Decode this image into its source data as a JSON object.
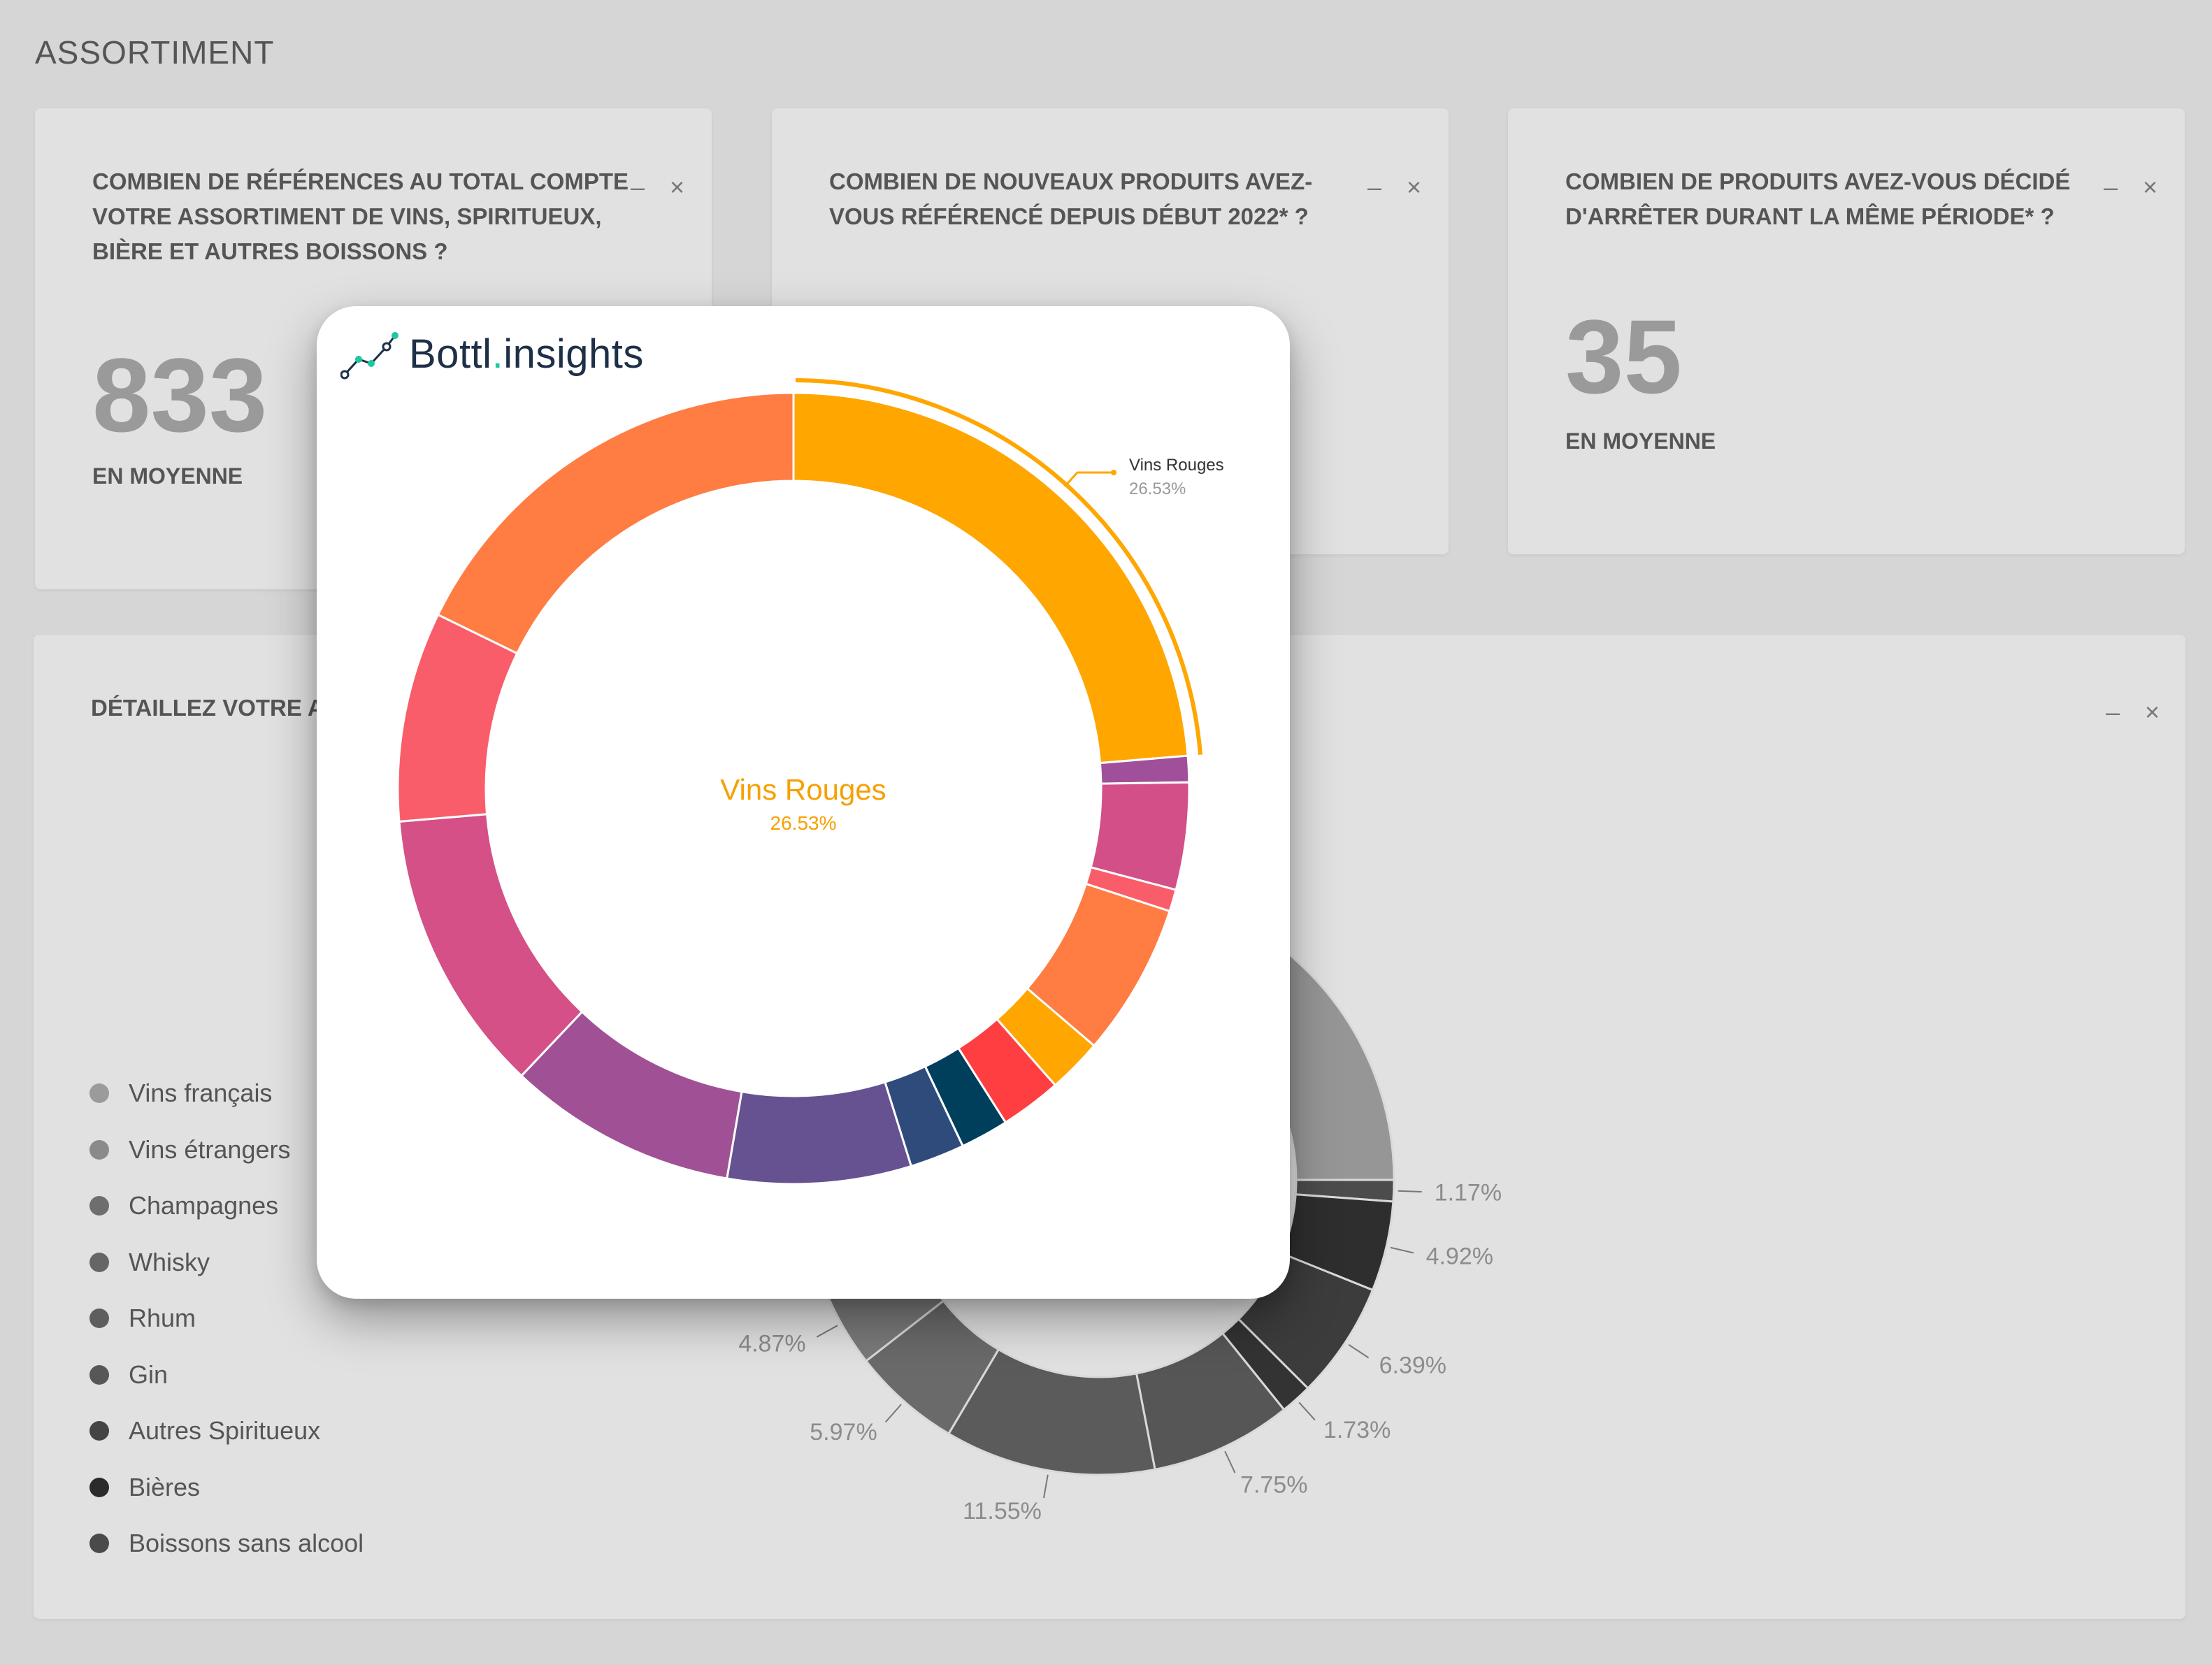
{
  "page": {
    "title": "ASSORTIMENT"
  },
  "cards": [
    {
      "question": "COMBIEN DE RÉFÉRENCES AU TOTAL COMPTE VOTRE ASSORTIMENT DE VINS, SPIRITUEUX, BIÈRE ET AUTRES BOISSONS ?",
      "value": "833",
      "caption": "EN MOYENNE"
    },
    {
      "question": "COMBIEN DE NOUVEAUX PRODUITS AVEZ-VOUS RÉFÉRENCÉ DEPUIS DÉBUT 2022* ?"
    },
    {
      "question": "COMBIEN DE PRODUITS AVEZ-VOUS DÉCIDÉ D'ARRÊTER DURANT LA MÊME PÉRIODE* ?",
      "value": "35",
      "caption": "EN MOYENNE"
    }
  ],
  "card_controls": {
    "minimize": "–",
    "close": "×"
  },
  "detail_card": {
    "question": "DÉTAILLEZ VOTRE A",
    "legend": [
      {
        "label": "Vins français",
        "color": "#9b9b9b"
      },
      {
        "label": "Vins étrangers",
        "color": "#8a8a8a"
      },
      {
        "label": "Champagnes",
        "color": "#6e6e6e"
      },
      {
        "label": "Whisky",
        "color": "#666666"
      },
      {
        "label": "Rhum",
        "color": "#5e5e5e"
      },
      {
        "label": "Gin",
        "color": "#575757"
      },
      {
        "label": "Autres Spiritueux",
        "color": "#444444"
      },
      {
        "label": "Bières",
        "color": "#2b2b2b"
      },
      {
        "label": "Boissons sans alcool",
        "color": "#4a4a4a"
      }
    ],
    "chart_data": {
      "type": "pie",
      "labels_visible": [
        "1.17%",
        "4.92%",
        "6.39%",
        "1.73%",
        "7.75%",
        "11.55%",
        "5.97%",
        "4.87%"
      ],
      "values": [
        1.17,
        4.92,
        6.39,
        1.73,
        7.75,
        11.55,
        5.97,
        4.87
      ]
    }
  },
  "popup": {
    "brand": {
      "name_a": "Bottl",
      "dot": ".",
      "name_b": "insights"
    },
    "center_label": "Vins Rouges",
    "center_value": "26.53%",
    "callout_label": "Vins Rouges",
    "callout_value": "26.53%",
    "chart_data": {
      "type": "pie",
      "highlighted": "Vins Rouges",
      "values": [
        26.53,
        1.2,
        4.9,
        1.0,
        7.0,
        2.5,
        2.8,
        2.2,
        2.5,
        8.4,
        10.5,
        13.0,
        9.6,
        19.9
      ],
      "colors": [
        "#ffa600",
        "#a0509a",
        "#d24f88",
        "#f95d6a",
        "#ff7c43",
        "#ffa600",
        "#ff3e41",
        "#003f5c",
        "#2f4b7c",
        "#665191",
        "#a05195",
        "#d45087",
        "#f95d6a",
        "#ff7c43"
      ]
    }
  }
}
